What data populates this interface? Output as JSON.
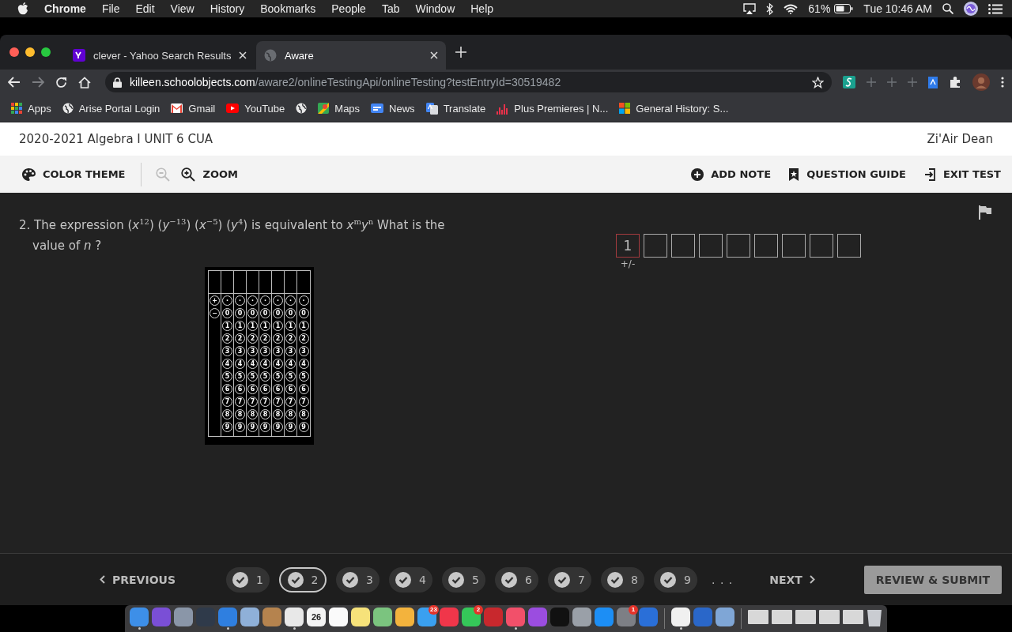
{
  "menu_bar": {
    "app_name": "Chrome",
    "menus": [
      "File",
      "Edit",
      "View",
      "History",
      "Bookmarks",
      "People",
      "Tab",
      "Window",
      "Help"
    ],
    "battery": "61%",
    "clock": "Tue 10:46 AM"
  },
  "browser": {
    "tabs": [
      {
        "title": "clever - Yahoo Search Results",
        "kind": "yahoo",
        "selected": false
      },
      {
        "title": "Aware",
        "kind": "globe",
        "selected": true
      }
    ],
    "forward_disabled": true,
    "address": {
      "host": "killeen.schoolobjects.com",
      "path": "/aware2/onlineTestingApi/onlineTesting?testEntryId=30519482"
    },
    "bookmarks": [
      {
        "label": "Apps",
        "kind": "apps"
      },
      {
        "label": "Arise Portal Login",
        "kind": "globe"
      },
      {
        "label": "Gmail",
        "kind": "gmail"
      },
      {
        "label": "YouTube",
        "kind": "youtube"
      },
      {
        "kind": "globe"
      },
      {
        "label": "Maps",
        "kind": "maps"
      },
      {
        "label": "News",
        "kind": "news"
      },
      {
        "label": "Translate",
        "kind": "translate"
      },
      {
        "label": "Plus Premieres | N...",
        "kind": "bars"
      },
      {
        "label": "General History: S...",
        "kind": "squares"
      }
    ]
  },
  "test": {
    "title": "2020-2021 Algebra I UNIT 6 CUA",
    "student": "Zi'Air Dean",
    "color_theme": "COLOR THEME",
    "zoom": "ZOOM",
    "zoom_out_disabled": true,
    "tools": [
      {
        "label": "ADD NOTE",
        "kind": "add"
      },
      {
        "label": "QUESTION GUIDE",
        "kind": "guide"
      },
      {
        "label": "EXIT TEST",
        "kind": "exit"
      }
    ],
    "question": "2. The expression (*x*$^{12}$) (*y*$^{−13}$) (*x*$^{−5}$) (*y*$^{4}$)  is equivalent to *x*$^{m}$*y*$^{n}$  What is the value of *n* ?",
    "bubble_grid": {
      "sign_column": [
        "+",
        "−"
      ],
      "digit_columns": [
        {
          "bubbles": [
            "·",
            "0",
            "1",
            "2",
            "3",
            "4",
            "5",
            "6",
            "7",
            "8",
            "9"
          ]
        },
        {
          "bubbles": [
            "·",
            "0",
            "1",
            "2",
            "3",
            "4",
            "5",
            "6",
            "7",
            "8",
            "9"
          ]
        },
        {
          "bubbles": [
            "·",
            "0",
            "1",
            "2",
            "3",
            "4",
            "5",
            "6",
            "7",
            "8",
            "9"
          ]
        },
        {
          "bubbles": [
            "·",
            "0",
            "1",
            "2",
            "3",
            "4",
            "5",
            "6",
            "7",
            "8",
            "9"
          ]
        },
        {
          "bubbles": [
            "·",
            "0",
            "1",
            "2",
            "3",
            "4",
            "5",
            "6",
            "7",
            "8",
            "9"
          ]
        },
        {
          "bubbles": [
            "·",
            "0",
            "1",
            "2",
            "3",
            "4",
            "5",
            "6",
            "7",
            "8",
            "9"
          ]
        },
        {
          "bubbles": [
            "·",
            "0",
            "1",
            "2",
            "3",
            "4",
            "5",
            "6",
            "7",
            "8",
            "9"
          ]
        }
      ]
    },
    "answer": {
      "sign_label": "+/-",
      "boxes": [
        {
          "value": "1",
          "selected": true
        },
        {
          "selected": false
        },
        {
          "selected": false
        },
        {
          "selected": false
        },
        {
          "selected": false
        },
        {
          "selected": false
        },
        {
          "selected": false
        },
        {
          "selected": false
        },
        {
          "selected": false
        }
      ]
    },
    "nav": {
      "previous": "PREVIOUS",
      "next": "NEXT",
      "more": ". . .",
      "submit": "REVIEW & SUBMIT",
      "questions": [
        {
          "label": "1",
          "answered": true,
          "selected": false
        },
        {
          "label": "2",
          "answered": true,
          "selected": true
        },
        {
          "label": "3",
          "answered": true,
          "selected": false
        },
        {
          "label": "4",
          "answered": true,
          "selected": false
        },
        {
          "label": "5",
          "answered": true,
          "selected": false
        },
        {
          "label": "6",
          "answered": true,
          "selected": false
        },
        {
          "label": "7",
          "answered": true,
          "selected": false
        },
        {
          "label": "8",
          "answered": true,
          "selected": false
        },
        {
          "label": "9",
          "answered": true,
          "selected": false
        }
      ]
    }
  },
  "dock": {
    "sections": [
      [
        {
          "kind": "app",
          "color": "#3d8fe8",
          "running": true
        },
        {
          "kind": "app",
          "color": "#7a4fd6",
          "running": false
        },
        {
          "kind": "app",
          "color": "#8a96a8",
          "running": false
        },
        {
          "kind": "app",
          "color": "#2f3a4a",
          "running": false
        },
        {
          "kind": "app",
          "color": "#2f7fe0",
          "running": true
        },
        {
          "kind": "app",
          "color": "#8fb0d8",
          "running": false
        },
        {
          "kind": "app",
          "color": "#b5834e",
          "running": false
        },
        {
          "kind": "app",
          "color": "#e8e8e8",
          "running": true
        },
        {
          "kind": "app",
          "color": "#f4f4f4",
          "label": "26",
          "running": false
        },
        {
          "kind": "app",
          "color": "#fafafa",
          "running": false
        },
        {
          "kind": "app",
          "color": "#f6e27a",
          "running": false
        },
        {
          "kind": "app",
          "color": "#7bc47f",
          "running": false
        },
        {
          "kind": "app",
          "color": "#f3b33d",
          "running": false
        },
        {
          "kind": "app",
          "color": "#3aa0f0",
          "badge": "23",
          "running": false
        },
        {
          "kind": "app",
          "color": "#f0364a",
          "running": false
        },
        {
          "kind": "app",
          "color": "#35c759",
          "badge": "2",
          "running": false
        },
        {
          "kind": "app",
          "color": "#c8282d",
          "running": false
        },
        {
          "kind": "app",
          "color": "#f2506a",
          "running": true
        },
        {
          "kind": "app",
          "color": "#9b4de0",
          "running": false
        },
        {
          "kind": "app",
          "color": "#111111",
          "running": false
        },
        {
          "kind": "app",
          "color": "#9aa0a8",
          "running": false
        },
        {
          "kind": "app",
          "color": "#1c8ef5",
          "running": false
        },
        {
          "kind": "app",
          "color": "#7d7f85",
          "badge": "1",
          "running": false
        },
        {
          "kind": "app",
          "color": "#2a6fd8",
          "running": false
        }
      ],
      [
        {
          "kind": "app",
          "color": "#f0f0f0",
          "running": true
        },
        {
          "kind": "app",
          "color": "#2a67c9",
          "running": false
        },
        {
          "kind": "app",
          "color": "#7fa6d6",
          "running": false
        }
      ],
      [
        {
          "kind": "thumb",
          "color": "#d8d8d8",
          "running": false
        },
        {
          "kind": "thumb",
          "color": "#d8d8d8",
          "running": false
        },
        {
          "kind": "thumb",
          "color": "#d8d8d8",
          "running": false
        },
        {
          "kind": "thumb",
          "color": "#d8d8d8",
          "running": false
        },
        {
          "kind": "thumb",
          "color": "#d8d8d8",
          "running": false
        },
        {
          "kind": "trash",
          "color": "#c9ccd1",
          "running": false
        }
      ]
    ]
  }
}
